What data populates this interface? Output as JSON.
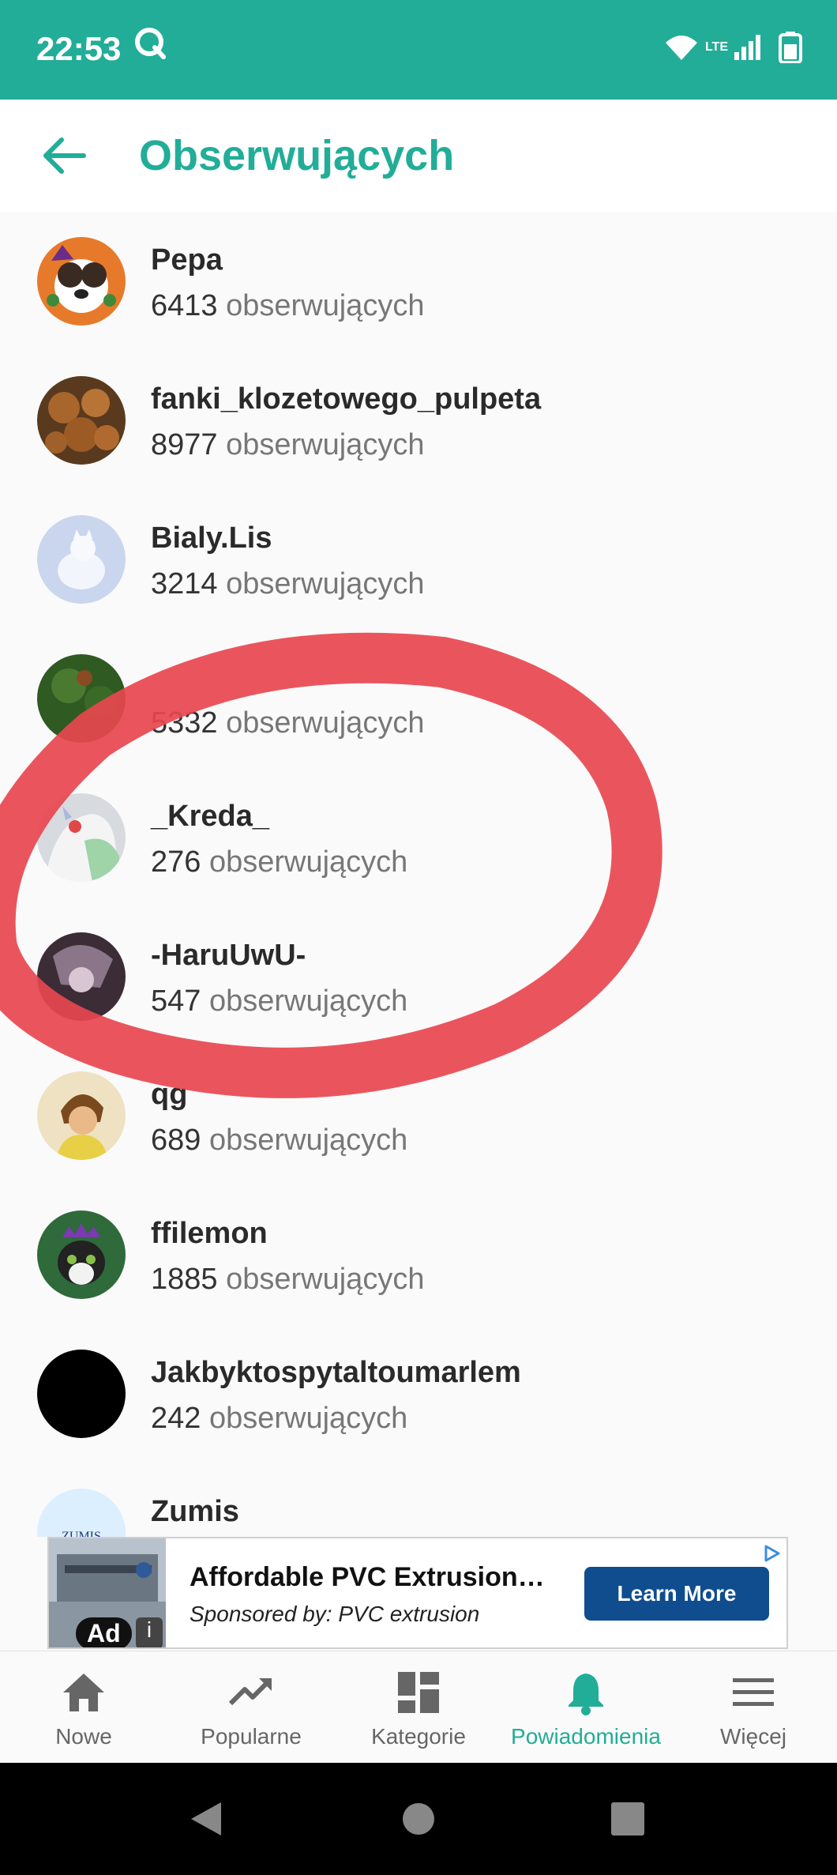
{
  "status_bar": {
    "time": "22:53",
    "q_icon": "q-logo-icon",
    "wifi_icon": "wifi-icon",
    "network_label": "LTE",
    "signal_icon": "signal-icon",
    "battery_icon": "battery-icon"
  },
  "header": {
    "back_icon": "back-arrow-icon",
    "title": "Obserwujących"
  },
  "followers": [
    {
      "name": "Pepa",
      "count": "6413",
      "unit": "obserwujących"
    },
    {
      "name": "fanki_klozetowego_pulpeta",
      "count": "8977",
      "unit": "obserwujących"
    },
    {
      "name": "Bialy.Lis",
      "count": "3214",
      "unit": "obserwujących"
    },
    {
      "name": "",
      "count": "5332",
      "unit": "obserwujących"
    },
    {
      "name": "_Kreda_",
      "count": "276",
      "unit": "obserwujących"
    },
    {
      "name": "-HaruUwU-",
      "count": "547",
      "unit": "obserwujących"
    },
    {
      "name": "qg",
      "count": "689",
      "unit": "obserwujących"
    },
    {
      "name": "ffilemon",
      "count": "1885",
      "unit": "obserwujących"
    },
    {
      "name": "Jakbyktospytaltoumarlem",
      "count": "242",
      "unit": "obserwujących"
    },
    {
      "name": "Zumis",
      "count": "",
      "unit": "",
      "avatar_text": "ZUMIS"
    }
  ],
  "ad": {
    "badge": "Ad",
    "info": "i",
    "title": "Affordable PVC Extrusion…",
    "sponsor": "Sponsored by: PVC extrusion",
    "cta": "Learn More",
    "choices_icon": "ad-choices-icon"
  },
  "nav": [
    {
      "label": "Nowe",
      "icon": "home-icon"
    },
    {
      "label": "Popularne",
      "icon": "trending-icon"
    },
    {
      "label": "Kategorie",
      "icon": "grid-icon"
    },
    {
      "label": "Powiadomienia",
      "icon": "bell-icon",
      "active": true
    },
    {
      "label": "Więcej",
      "icon": "menu-icon"
    }
  ],
  "colors": {
    "accent": "#22ad98",
    "annotation": "#e8474f",
    "ad_cta": "#0f4d8f"
  }
}
